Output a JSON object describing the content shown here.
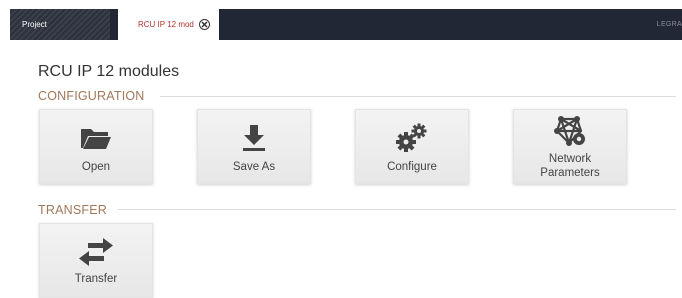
{
  "tabs": {
    "project_label": "Project",
    "active_label": "RCU IP 12 mod",
    "brand": "LEGRA"
  },
  "page": {
    "title": "RCU IP 12 modules"
  },
  "sections": {
    "configuration": {
      "label": "CONFIGURATION",
      "tiles": [
        {
          "label": "Open",
          "icon": "folder-open-icon"
        },
        {
          "label": "Save As",
          "icon": "download-icon"
        },
        {
          "label": "Configure",
          "icon": "gears-icon"
        },
        {
          "label_line1": "Network",
          "label_line2": "Parameters",
          "icon": "network-gear-icon"
        }
      ]
    },
    "transfer": {
      "label": "TRANSFER",
      "tiles": [
        {
          "label": "Transfer",
          "icon": "exchange-arrows-icon"
        }
      ]
    }
  },
  "colors": {
    "tabstrip": "#222735",
    "active_tab_text": "#b5332e",
    "section_label": "#a0785a",
    "icon": "#444444"
  }
}
